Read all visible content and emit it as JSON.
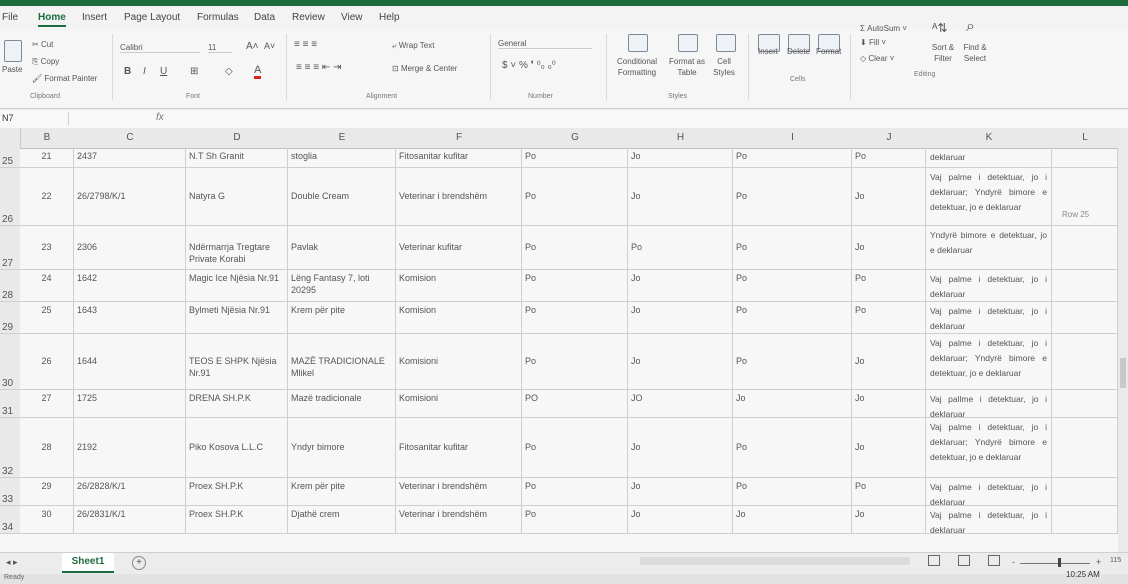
{
  "menu": [
    "File",
    "Home",
    "Insert",
    "Page Layout",
    "Formulas",
    "Data",
    "Review",
    "View",
    "Help"
  ],
  "ribbon": {
    "paste": "Paste",
    "cut": "Cut",
    "copy": "Copy",
    "format_painter": "Format Painter",
    "clipboard": "Clipboard",
    "font_name": "Calibri",
    "font_size": "11",
    "font_group": "Font",
    "wrap_text": "Wrap Text",
    "merge_center": "Merge & Center",
    "alignment_group": "Alignment",
    "number_format": "General",
    "number_group": "Number",
    "conditional_formatting": "Conditional Formatting",
    "format_as_table": "Format as Table",
    "cell_styles": "Cell Styles",
    "styles_group": "Styles",
    "insert": "Insert",
    "delete": "Delete",
    "format": "Format",
    "cells_group": "Cells",
    "autosum": "AutoSum",
    "fill": "Fill",
    "clear": "Clear",
    "sort_filter": "Sort & Filter",
    "find_select": "Find & Select",
    "editing_group": "Editing"
  },
  "name_box": "N7",
  "fx": "fx",
  "columns": [
    "B",
    "C",
    "D",
    "E",
    "F",
    "G",
    "H",
    "I",
    "J",
    "K",
    "L"
  ],
  "rows": [
    {
      "row": "25",
      "num": "21",
      "id": "2437",
      "name": "N.T Sh Granit",
      "product": "stoglia",
      "control": "Fitosanitar kufitar",
      "g": "Po",
      "h": "Jo",
      "i": "Po",
      "j": "Po",
      "k": "deklaruar"
    },
    {
      "row": "26",
      "num": "22",
      "id": "26/2798/K/1",
      "name": "Natyra G",
      "product": "Double Cream",
      "control": "Veterinar i brendshëm",
      "g": "Po",
      "h": "Jo",
      "i": "Po",
      "j": "Jo",
      "k": "Vaj palme i detektuar, jo i deklaruar; Yndyrë bimore e detektuar, jo e deklaruar"
    },
    {
      "row": "27",
      "num": "23",
      "id": "2306",
      "name": "Ndërmarrja Tregtare Private Korabi",
      "product": "Pavlak",
      "control": "Veterinar kufitar",
      "g": "Po",
      "h": "Po",
      "i": "Po",
      "j": "Jo",
      "k": "Yndyrë bimore e detektuar, jo e deklaruar"
    },
    {
      "row": "28",
      "num": "24",
      "id": "1642",
      "name": "Magic Ice Njësia Nr.91",
      "product": "Lëng Fantasy 7, loti 20295",
      "control": "Komision",
      "g": "Po",
      "h": "Jo",
      "i": "Po",
      "j": "Po",
      "k": "Vaj palme i detektuar, jo i deklaruar"
    },
    {
      "row": "29",
      "num": "25",
      "id": "1643",
      "name": "Bylmeti Njësia Nr.91",
      "product": "Krem për pite",
      "control": "Komision",
      "g": "Po",
      "h": "Jo",
      "i": "Po",
      "j": "Po",
      "k": "Vaj palme i detektuar, jo i deklaruar"
    },
    {
      "row": "30",
      "num": "26",
      "id": "1644",
      "name": "TEOS E SHPK Njësia Nr.91",
      "product": "MAZË TRADICIONALE Mlikel",
      "control": "Komisioni",
      "g": "Po",
      "h": "Jo",
      "i": "Po",
      "j": "Jo",
      "k": "Vaj palme i detektuar, jo i deklaruar; Yndyrë bimore e detektuar, jo e deklaruar"
    },
    {
      "row": "31",
      "num": "27",
      "id": "1725",
      "name": "DRENA SH.P.K",
      "product": "Mazë tradicionale",
      "control": "Komisioni",
      "g": "PO",
      "h": "JO",
      "i": "Jo",
      "j": "Jo",
      "k": "Vaj pallme i detektuar, jo i deklaruar"
    },
    {
      "row": "32",
      "num": "28",
      "id": "2192",
      "name": "Piko Kosova L.L.C",
      "product": "Yndyr bimore",
      "control": "Fitosanitar kufitar",
      "g": "Po",
      "h": "Jo",
      "i": "Po",
      "j": "Jo",
      "k": "Vaj palme i detektuar, jo i deklaruar; Yndyrë bimore e detektuar, jo e deklaruar"
    },
    {
      "row": "33",
      "num": "29",
      "id": "26/2828/K/1",
      "name": "Proex SH.P.K",
      "product": "Krem për pite",
      "control": "Veterinar i brendshëm",
      "g": "Po",
      "h": "Jo",
      "i": "Po",
      "j": "Po",
      "k": "Vaj palme i detektuar, jo i deklaruar"
    },
    {
      "row": "34",
      "num": "30",
      "id": "26/2831/K/1",
      "name": "Proex SH.P.K",
      "product": "Djathë crem",
      "control": "Veterinar i brendshëm",
      "g": "Po",
      "h": "Jo",
      "i": "Jo",
      "j": "Jo",
      "k": "Vaj palme i detektuar, jo i deklaruar"
    }
  ],
  "row_label": "Row 25",
  "sheet_tab": "Sheet1",
  "add_sheet": "+",
  "status": "Ready",
  "clock": "10:25 AM",
  "zoom": "115"
}
